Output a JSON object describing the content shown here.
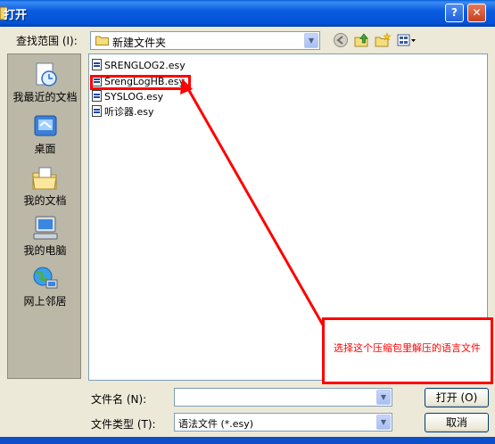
{
  "window": {
    "title": "打开",
    "help_label": "?",
    "close_label": "✕"
  },
  "lookin": {
    "label": "查找范围 (I):",
    "value": "新建文件夹",
    "icons": [
      "back-icon",
      "up-folder-icon",
      "new-folder-icon",
      "view-menu-icon"
    ]
  },
  "places": [
    {
      "label": "我最近的文档",
      "icon": "recent-documents-icon"
    },
    {
      "label": "桌面",
      "icon": "desktop-icon"
    },
    {
      "label": "我的文档",
      "icon": "my-documents-icon"
    },
    {
      "label": "我的电脑",
      "icon": "my-computer-icon"
    },
    {
      "label": "网上邻居",
      "icon": "network-places-icon"
    }
  ],
  "files": [
    {
      "name": "SRENGLOG2.esy"
    },
    {
      "name": "SrengLogHB.esy"
    },
    {
      "name": "SYSLOG.esy"
    },
    {
      "name": "听诊器.esy"
    }
  ],
  "annotation": {
    "text": "选择这个压缩包里解压的语言文件",
    "color": "#ff0000"
  },
  "filename": {
    "label": "文件名 (N):",
    "value": ""
  },
  "filetype": {
    "label": "文件类型 (T):",
    "value": "语法文件 (*.esy)"
  },
  "buttons": {
    "open": "打开 (O)",
    "cancel": "取消"
  },
  "colors": {
    "titlebar": "#0052d6",
    "dialog": "#ece9d8",
    "places_bar": "#bbb8a8",
    "accent_red": "#ff0000"
  }
}
